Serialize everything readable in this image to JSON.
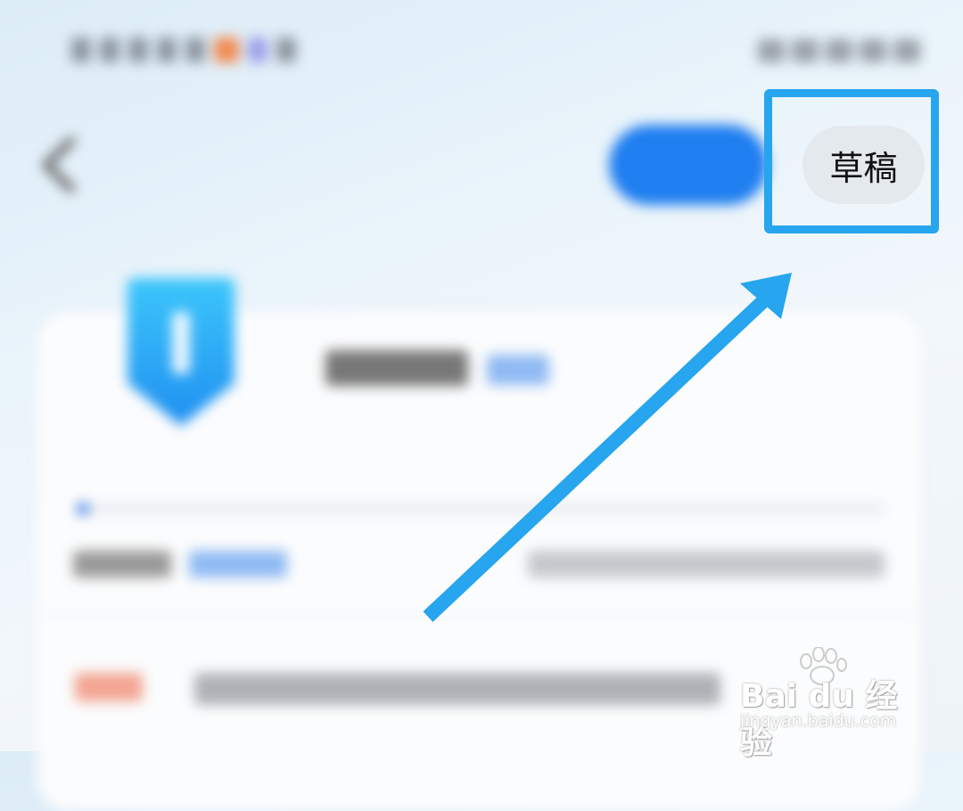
{
  "header": {
    "draft_label": "草稿"
  },
  "watermark": {
    "logo_text": "Bai du 经验",
    "url": "jingyan.baidu.com"
  },
  "colors": {
    "highlight": "#27a5ee",
    "publish_button": "#1f7ef0",
    "draft_button_bg": "#e4e9ee",
    "arrow": "#27a5ee"
  },
  "icons": {
    "back": "chevron-left-icon",
    "arrow": "arrow-up-right-icon"
  }
}
